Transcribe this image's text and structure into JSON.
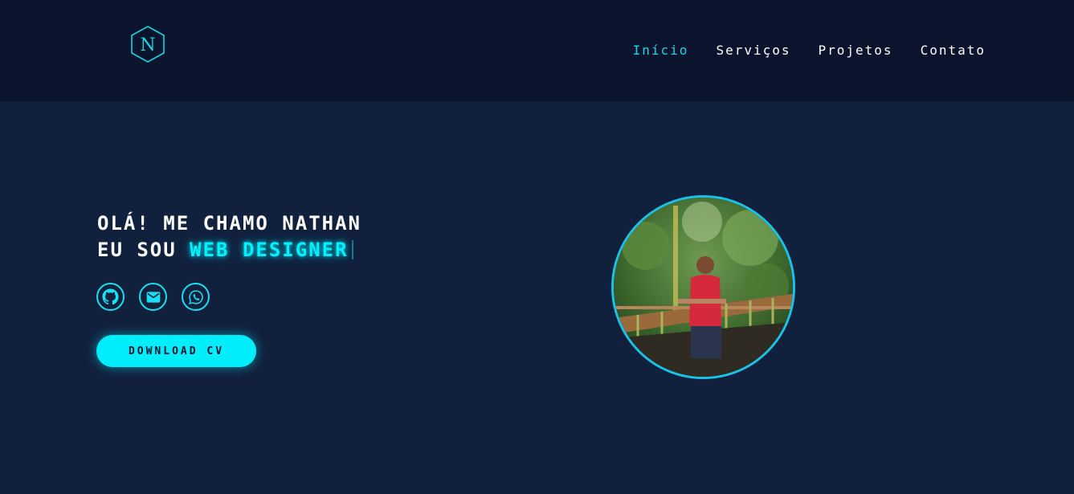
{
  "header": {
    "logo_letter": "N",
    "nav": [
      {
        "label": "Início",
        "active": true
      },
      {
        "label": "Serviços",
        "active": false
      },
      {
        "label": "Projetos",
        "active": false
      },
      {
        "label": "Contato",
        "active": false
      }
    ]
  },
  "hero": {
    "line1": "Olá! Me chamo Nathan",
    "line2_prefix": "Eu sou",
    "line2_highlight": "Web Designer",
    "socials": [
      {
        "icon": "github-icon"
      },
      {
        "icon": "mail-icon"
      },
      {
        "icon": "whatsapp-icon"
      }
    ],
    "cta_label": "DOWNLOAD CV",
    "photo_icon": "profile-photo"
  },
  "colors": {
    "accent": "#00f0ff",
    "header_bg": "#0a142c",
    "page_bg": "#11203d",
    "text": "#ffffff"
  }
}
